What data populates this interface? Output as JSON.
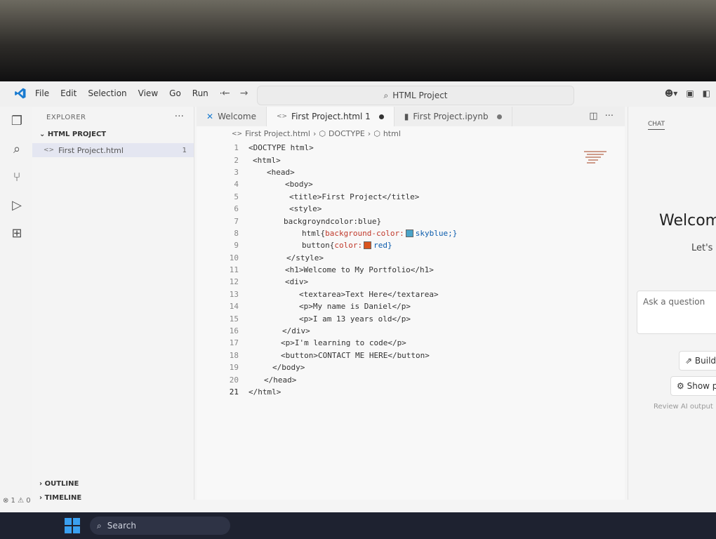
{
  "titlebar": {
    "menu": [
      "File",
      "Edit",
      "Selection",
      "View",
      "Go",
      "Run",
      "···"
    ],
    "command_center": "HTML Project"
  },
  "sidebar": {
    "header": "EXPLORER",
    "more": "···",
    "project": "HTML PROJECT",
    "file": "First Project.html",
    "file_problems": "1",
    "outline": "OUTLINE",
    "timeline": "TIMELINE",
    "status": "⊗ 1 ⚠ 0"
  },
  "editor": {
    "tabs": [
      {
        "label": "Welcome"
      },
      {
        "label": "First Project.html 1"
      },
      {
        "label": "First Project.ipynb"
      }
    ],
    "breadcrumb": [
      "First Project.html",
      "DOCTYPE",
      "html"
    ],
    "lines": [
      "1",
      "2",
      "3",
      "4",
      "5",
      "6",
      "7",
      "8",
      "9",
      "10",
      "11",
      "12",
      "13",
      "14",
      "15",
      "16",
      "17",
      "18",
      "19",
      "20",
      "21"
    ],
    "code": {
      "l1": "<DOCTYPE html>",
      "l2": "<html>",
      "l3": "<head>",
      "l4": "<body>",
      "l5": "<title>First Project</title>",
      "l6": "<style>",
      "l7": "backgroyndcolor:blue}",
      "l8a": "html{",
      "l8b": "background-color:",
      "l8c": "skyblue;}",
      "l9a": "button{",
      "l9b": "color:",
      "l9c": "red}",
      "l10": "</style>",
      "l11": "<h1>Welcome to My Portfolio</h1>",
      "l12": "<div>",
      "l13": "<textarea>Text Here</textarea>",
      "l14": "<p>My name is Daniel</p>",
      "l15": "<p>I am 13 years old</p>",
      "l16": "</div>",
      "l17": "<p>I'm learning to code</p>",
      "l18": "<button>CONTACT ME HERE</button>",
      "l19": "</body>",
      "l20": "</head>",
      "l21": "</html>"
    },
    "swatch_skyblue": "#4aa3c8",
    "swatch_red": "#d9541e"
  },
  "chat": {
    "tab": "CHAT",
    "welcome": "Welcom",
    "lets": "Let's",
    "input_placeholder": "Ask a question",
    "build": "Build",
    "show": "Show p",
    "review": "Review AI output"
  },
  "taskbar": {
    "search": "Search"
  }
}
